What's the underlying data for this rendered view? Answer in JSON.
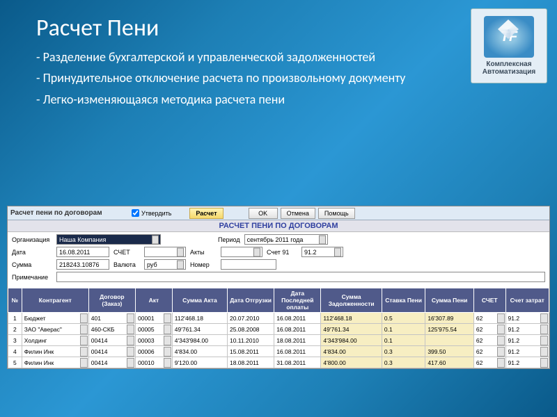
{
  "slide": {
    "title": "Расчет Пени",
    "bullets": [
      "- Разделение бухгалтерской и управленческой задолженностей",
      "- Принудительное отключение расчета по произвольному документу",
      "- Легко-изменяющаяся методика расчета пени"
    ],
    "logo": {
      "initials": "TF",
      "line1": "Комплексная",
      "line2": "Автоматизация"
    }
  },
  "app": {
    "titlebar": {
      "title": "Расчет пени по договорам",
      "confirm_label": "Утвердить",
      "calc_label": "Расчет",
      "ok_label": "OK",
      "cancel_label": "Отмена",
      "help_label": "Помощь"
    },
    "banner": "РАСЧЕТ ПЕНИ ПО ДОГОВОРАМ",
    "form": {
      "org_label": "Организация",
      "org_value": "Наша Компания",
      "period_label": "Период",
      "period_value": "сентябрь 2011 года",
      "date_label": "Дата",
      "date_value": "16.08.2011",
      "schet_label": "СЧЕТ",
      "akty_label": "Акты",
      "schet91_label": "Счет 91",
      "schet91_value": "91.2",
      "sum_label": "Сумма",
      "sum_value": "218243.10876",
      "currency_label": "Валюта",
      "currency_value": "руб",
      "number_label": "Номер",
      "note_label": "Примечание"
    },
    "columns": [
      "№",
      "Контрагент",
      "Договор (Заказ)",
      "Акт",
      "Сумма Акта",
      "Дата Отгрузки",
      "Дата Последней оплаты",
      "Сумма Задолженности",
      "Ставка Пени",
      "Сумма Пени",
      "СЧЕТ",
      "Счет затрат"
    ],
    "rows": [
      {
        "n": "1",
        "k": "Бюджет",
        "d": "401",
        "a": "00001",
        "sa": "112'468.18",
        "do": "20.07.2010",
        "dp": "16.08.2011",
        "sz": "112'468.18",
        "st": "0.5",
        "sp": "16'307.89",
        "sc": "62",
        "cz": "91.2"
      },
      {
        "n": "2",
        "k": "ЗАО \"Аверас\"",
        "d": "460-СКБ",
        "a": "00005",
        "sa": "49'761.34",
        "do": "25.08.2008",
        "dp": "16.08.2011",
        "sz": "49'761.34",
        "st": "0.1",
        "sp": "125'975.54",
        "sc": "62",
        "cz": "91.2"
      },
      {
        "n": "3",
        "k": "Холдинг",
        "d": "00414",
        "a": "00003",
        "sa": "4'343'984.00",
        "do": "10.11.2010",
        "dp": "18.08.2011",
        "sz": "4'343'984.00",
        "st": "0.1",
        "sp": "",
        "sc": "62",
        "cz": "91.2"
      },
      {
        "n": "4",
        "k": "Филин Инк",
        "d": "00414",
        "a": "00006",
        "sa": "4'834.00",
        "do": "15.08.2011",
        "dp": "16.08.2011",
        "sz": "4'834.00",
        "st": "0.3",
        "sp": "399.50",
        "sc": "62",
        "cz": "91.2"
      },
      {
        "n": "5",
        "k": "Филин Инк",
        "d": "00414",
        "a": "00010",
        "sa": "9'120.00",
        "do": "18.08.2011",
        "dp": "31.08.2011",
        "sz": "4'800.00",
        "st": "0.3",
        "sp": "417.60",
        "sc": "62",
        "cz": "91.2"
      }
    ]
  }
}
